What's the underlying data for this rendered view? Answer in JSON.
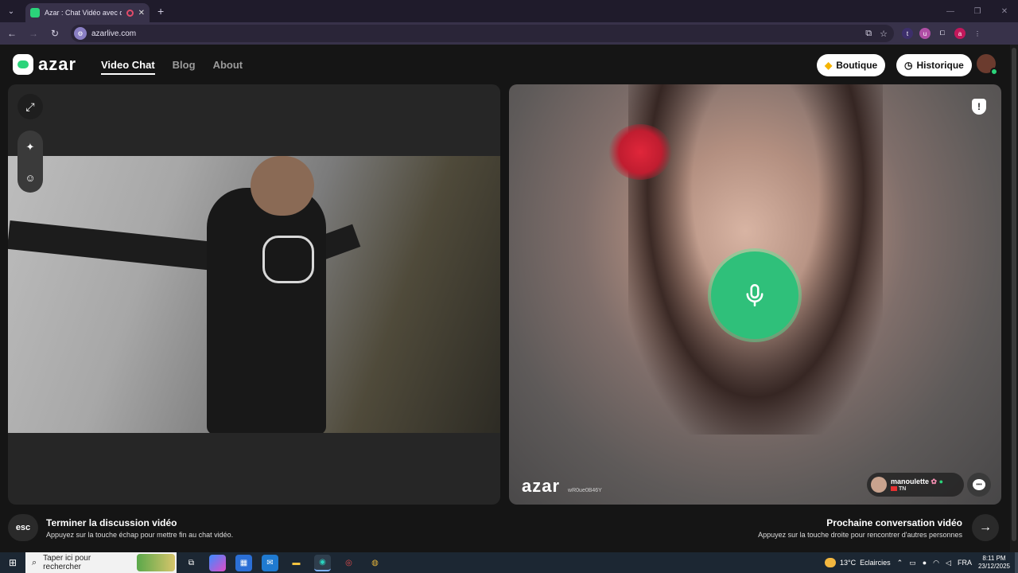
{
  "browser": {
    "tab_title": "Azar : Chat Vidéo avec de n",
    "url": "azarlive.com"
  },
  "header": {
    "logo_text": "azar",
    "nav": [
      {
        "label": "Video Chat",
        "active": true
      },
      {
        "label": "Blog",
        "active": false
      },
      {
        "label": "About",
        "active": false
      }
    ],
    "boutique_label": "Boutique",
    "historique_label": "Historique"
  },
  "right_panel": {
    "watermark_logo": "azar",
    "watermark_id": "wR0ue0B46Y",
    "partner": {
      "username": "manoulette",
      "country": "TN"
    }
  },
  "bottom": {
    "esc_label": "esc",
    "end_title": "Terminer la discussion vidéo",
    "end_sub": "Appuyez sur la touche échap pour mettre fin au chat vidéo.",
    "next_title": "Prochaine conversation vidéo",
    "next_sub": "Appuyez sur la touche droite pour rencontrer d'autres personnes"
  },
  "taskbar": {
    "search_placeholder": "Taper ici pour rechercher",
    "weather_temp": "13°C",
    "weather_text": "Eclaircies",
    "lang": "FRA",
    "time": "8:11 PM",
    "date": "23/12/2025"
  },
  "colors": {
    "accent_green": "#2fc07a",
    "page_bg": "#151515",
    "panel_bg": "#262626"
  },
  "icons": [
    "expand-icon",
    "sparkle-icon",
    "face-filter-icon",
    "report-shield-icon",
    "microphone-icon",
    "chat-icon",
    "arrow-right-icon"
  ]
}
